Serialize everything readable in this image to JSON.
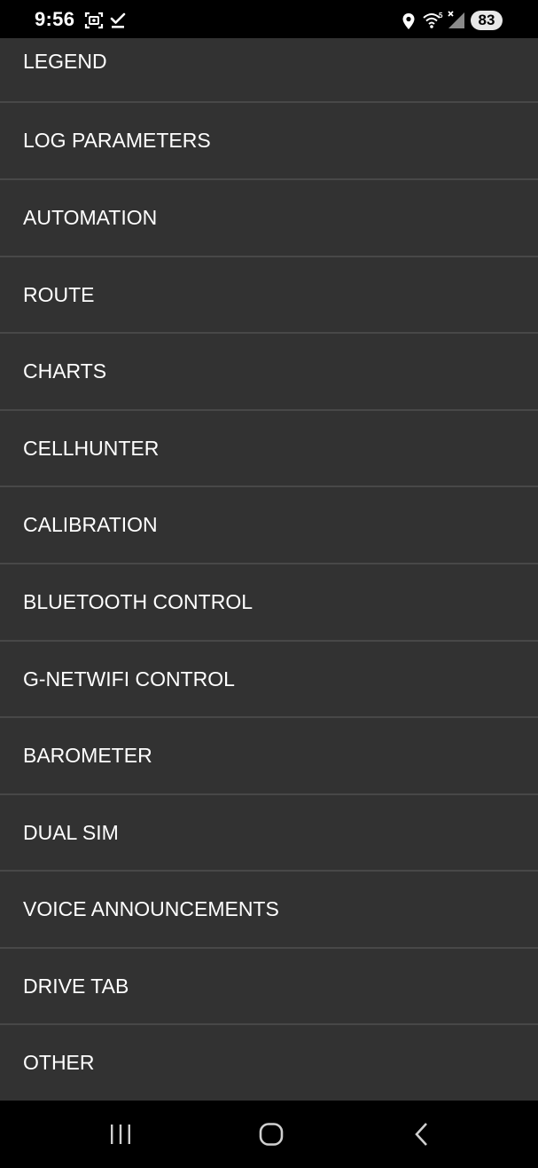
{
  "status_bar": {
    "time": "9:56",
    "battery_level": "83",
    "icons": [
      "screenshot-icon",
      "task-done-icon",
      "location-icon",
      "wifi-icon",
      "cellular-signal-icon",
      "battery-icon"
    ],
    "wifi_badge": "5"
  },
  "menu": {
    "items": [
      {
        "label": "LEGEND"
      },
      {
        "label": "LOG PARAMETERS"
      },
      {
        "label": "AUTOMATION"
      },
      {
        "label": "ROUTE"
      },
      {
        "label": "CHARTS"
      },
      {
        "label": "CELLHUNTER"
      },
      {
        "label": "CALIBRATION"
      },
      {
        "label": "BLUETOOTH CONTROL"
      },
      {
        "label": "G-NETWIFI CONTROL"
      },
      {
        "label": "BAROMETER"
      },
      {
        "label": "DUAL SIM"
      },
      {
        "label": "VOICE ANNOUNCEMENTS"
      },
      {
        "label": "DRIVE TAB"
      },
      {
        "label": "OTHER"
      }
    ]
  },
  "nav_bar": {
    "buttons": [
      "recent-apps-icon",
      "home-icon",
      "back-icon"
    ]
  },
  "colors": {
    "list_background": "#323232",
    "divider": "#484848",
    "text": "#ffffff",
    "bars": "#000000"
  }
}
